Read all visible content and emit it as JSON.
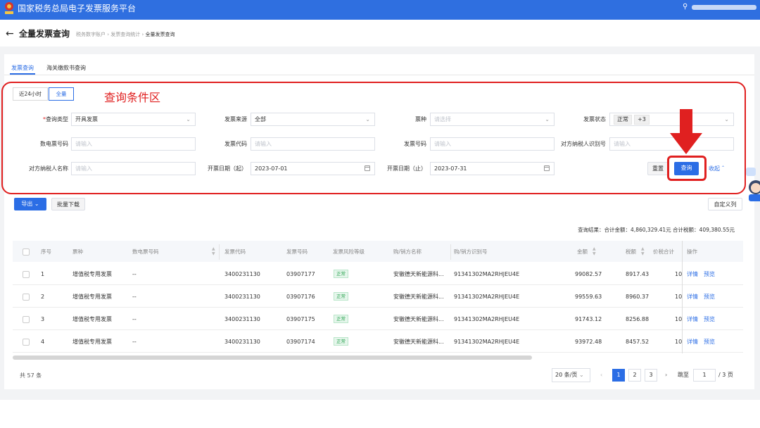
{
  "header": {
    "app_title": "国家税务总局电子发票服务平台"
  },
  "page": {
    "title": "全量发票查询",
    "breadcrumbs": [
      "税务数字账户",
      "发票查询统计",
      "全量发票查询"
    ]
  },
  "tabs": [
    "发票查询",
    "海关缴款书查询"
  ],
  "annotation": {
    "region_label": "查询条件区"
  },
  "time_range": {
    "options": [
      "近24小时",
      "全量"
    ],
    "selected": "全量"
  },
  "filters": {
    "query_type": {
      "label": "查询类型",
      "value": "开具发票"
    },
    "source": {
      "label": "发票来源",
      "value": "全部"
    },
    "kind": {
      "label": "票种",
      "placeholder": "请选择"
    },
    "status": {
      "label": "发票状态",
      "tags": [
        "正常",
        "+3"
      ]
    },
    "e_invoice_no": {
      "label": "数电票号码",
      "placeholder": "请输入"
    },
    "invoice_code": {
      "label": "发票代码",
      "placeholder": "请输入"
    },
    "invoice_no": {
      "label": "发票号码",
      "placeholder": "请输入"
    },
    "counterparty_id": {
      "label": "对方纳税人识别号",
      "placeholder": "请输入"
    },
    "counterparty_name": {
      "label": "对方纳税人名称",
      "placeholder": "请输入"
    },
    "date_start": {
      "label": "开票日期（起）",
      "value": "2023-07-01"
    },
    "date_end": {
      "label": "开票日期（止）",
      "value": "2023-07-31"
    }
  },
  "actions": {
    "reset": "重置",
    "query": "查询",
    "collapse": "收起"
  },
  "toolbar": {
    "export": "导出",
    "batch_download": "批量下载",
    "custom_columns": "自定义列"
  },
  "summary": "查询结果：合计金额：4,860,329.41元  合计税额：409,380.55元",
  "table": {
    "headers": [
      "序号",
      "票种",
      "数电票号码",
      "发票代码",
      "发票号码",
      "发票风险等级",
      "购/销方名称",
      "购/销方识别号",
      "金额",
      "税额",
      "价税合计",
      "操作"
    ],
    "rows": [
      {
        "no": "1",
        "kind": "增值税专用发票",
        "e_no": "--",
        "code": "3400231130",
        "number": "03907177",
        "risk": "正常",
        "name": "安徽德天新能源科...",
        "tax_id": "91341302MA2RHJEU4E",
        "amount": "99082.57",
        "tax": "8917.43",
        "total": "10",
        "detail": "详情",
        "preview": "预览"
      },
      {
        "no": "2",
        "kind": "增值税专用发票",
        "e_no": "--",
        "code": "3400231130",
        "number": "03907176",
        "risk": "正常",
        "name": "安徽德天新能源科...",
        "tax_id": "91341302MA2RHJEU4E",
        "amount": "99559.63",
        "tax": "8960.37",
        "total": "10",
        "detail": "详情",
        "preview": "预览"
      },
      {
        "no": "3",
        "kind": "增值税专用发票",
        "e_no": "--",
        "code": "3400231130",
        "number": "03907175",
        "risk": "正常",
        "name": "安徽德天新能源科...",
        "tax_id": "91341302MA2RHJEU4E",
        "amount": "91743.12",
        "tax": "8256.88",
        "total": "10",
        "detail": "详情",
        "preview": "预览"
      },
      {
        "no": "4",
        "kind": "增值税专用发票",
        "e_no": "--",
        "code": "3400231130",
        "number": "03907174",
        "risk": "正常",
        "name": "安徽德天新能源科...",
        "tax_id": "91341302MA2RHJEU4E",
        "amount": "93972.48",
        "tax": "8457.52",
        "total": "10",
        "detail": "详情",
        "preview": "预览"
      }
    ]
  },
  "pagination": {
    "total": "共 57 条",
    "page_size": "20 条/页",
    "pages": [
      "1",
      "2",
      "3"
    ],
    "current": "1",
    "goto_label": "跳至",
    "goto_value": "1",
    "page_count": "/ 3 页"
  },
  "colors": {
    "primary": "#2b6de5",
    "topbar": "#2f6fe0",
    "annotation_red": "#e02020",
    "ok_green": "#2aa450"
  },
  "icons": {
    "back": "arrow-left-icon",
    "user": "user-icon",
    "annotation": "down-arrow-icon"
  }
}
